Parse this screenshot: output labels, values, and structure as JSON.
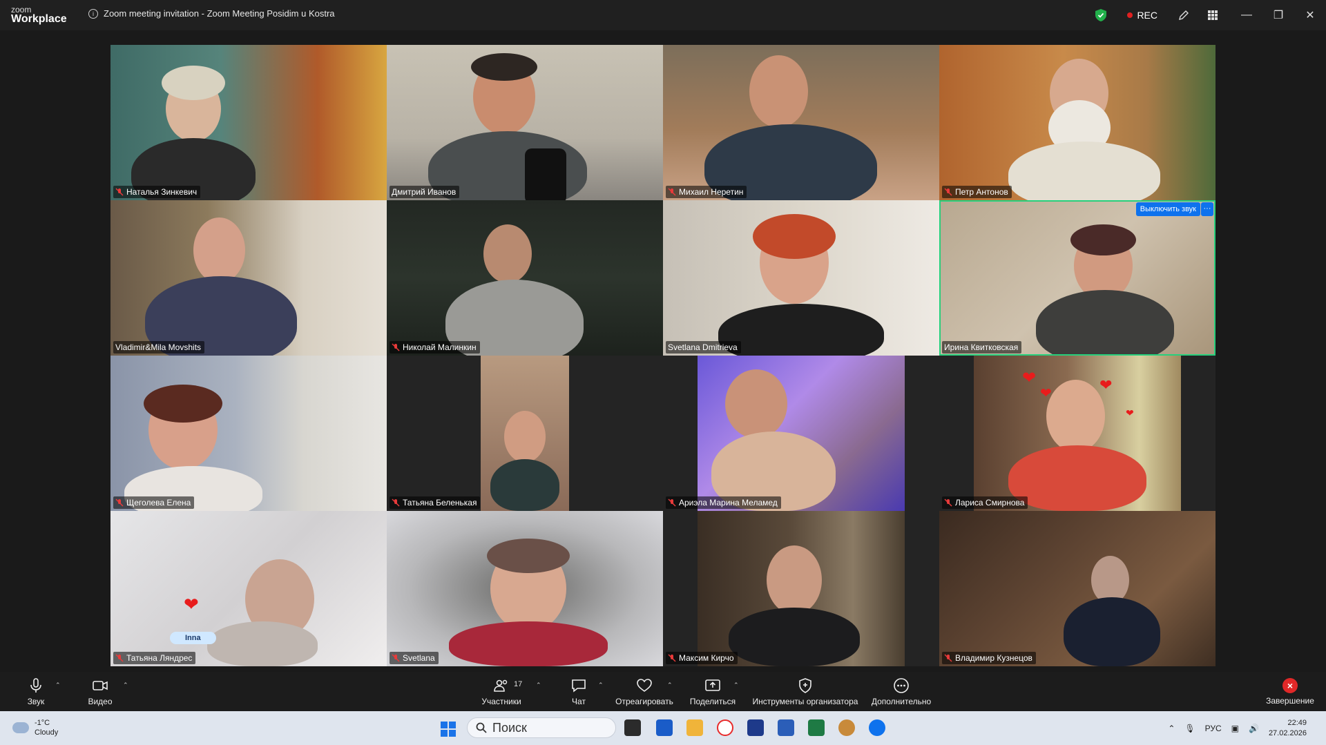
{
  "titlebar": {
    "brand_top": "zoom",
    "brand_bottom": "Workplace",
    "window_title": "Zoom meeting invitation - Zoom Meeting Posidim u Kostra",
    "rec_label": "REC"
  },
  "participants": [
    {
      "name": "Наталья Зинкевич",
      "muted": true
    },
    {
      "name": "Дмитрий Иванов",
      "muted": false
    },
    {
      "name": "Михаил Неретин",
      "muted": true
    },
    {
      "name": "Петр Антонов",
      "muted": true
    },
    {
      "name": "Vladimir&Mila Movshits",
      "muted": false
    },
    {
      "name": "Николай Малинкин",
      "muted": true
    },
    {
      "name": "Svetlana Dmitrieva",
      "muted": false
    },
    {
      "name": "Ирина Квитковская",
      "muted": false,
      "active_speaker": true
    },
    {
      "name": "Щеголева Елена",
      "muted": true
    },
    {
      "name": "Татьяна Беленькая",
      "muted": true
    },
    {
      "name": "Ариэла Марина Меламед",
      "muted": true
    },
    {
      "name": "Лариса Смирнова",
      "muted": true
    },
    {
      "name": "Татьяна Ляндрес",
      "muted": true
    },
    {
      "name": "Svetlana",
      "muted": true
    },
    {
      "name": "Максим Кирчо",
      "muted": true
    },
    {
      "name": "Владимир Кузнецов",
      "muted": true
    }
  ],
  "tile_actions": {
    "mute_label": "Выключить звук",
    "more_label": "···"
  },
  "reaction_bubble": "Inna",
  "toolbar": {
    "audio": "Звук",
    "video": "Видео",
    "participants": "Участники",
    "participants_count": "17",
    "chat": "Чат",
    "react": "Отреагировать",
    "share": "Поделиться",
    "host_tools": "Инструменты организатора",
    "more": "Дополнительно",
    "end": "Завершение"
  },
  "taskbar": {
    "temperature": "-1°C",
    "weather": "Cloudy",
    "search_placeholder": "Поиск",
    "language": "РУС",
    "time": "22:49",
    "date": "27.02.2026"
  },
  "colors": {
    "active_speaker_border": "#26d07c",
    "accent_blue": "#0e72ed",
    "rec_red": "#e02020",
    "mute_red": "#e83a3a"
  }
}
